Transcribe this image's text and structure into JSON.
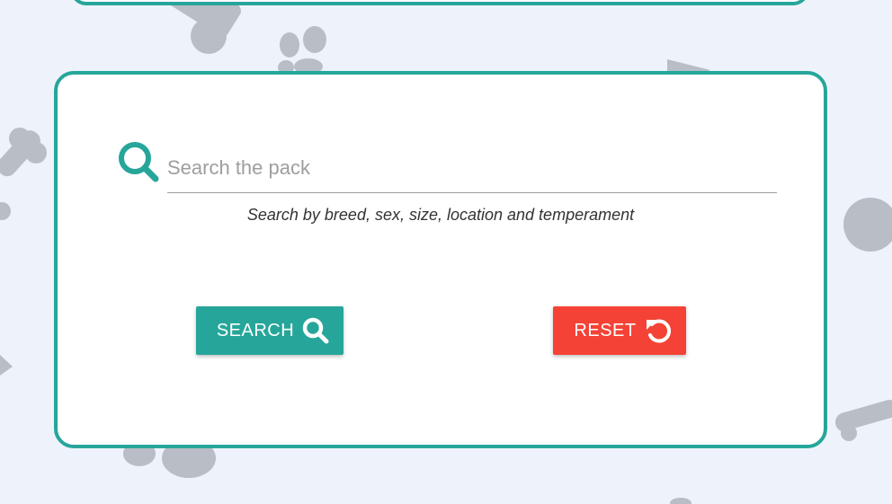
{
  "search": {
    "placeholder": "Search the pack",
    "value": "",
    "helper": "Search by breed, sex, size, location and temperament"
  },
  "buttons": {
    "search_label": "SEARCH",
    "search_icon": "search-icon",
    "reset_label": "RESET",
    "reset_icon": "undo-icon"
  },
  "colors": {
    "accent": "#26a69a",
    "danger": "#f44336",
    "background": "#eef3fb",
    "decor": "#b9bdc6"
  }
}
